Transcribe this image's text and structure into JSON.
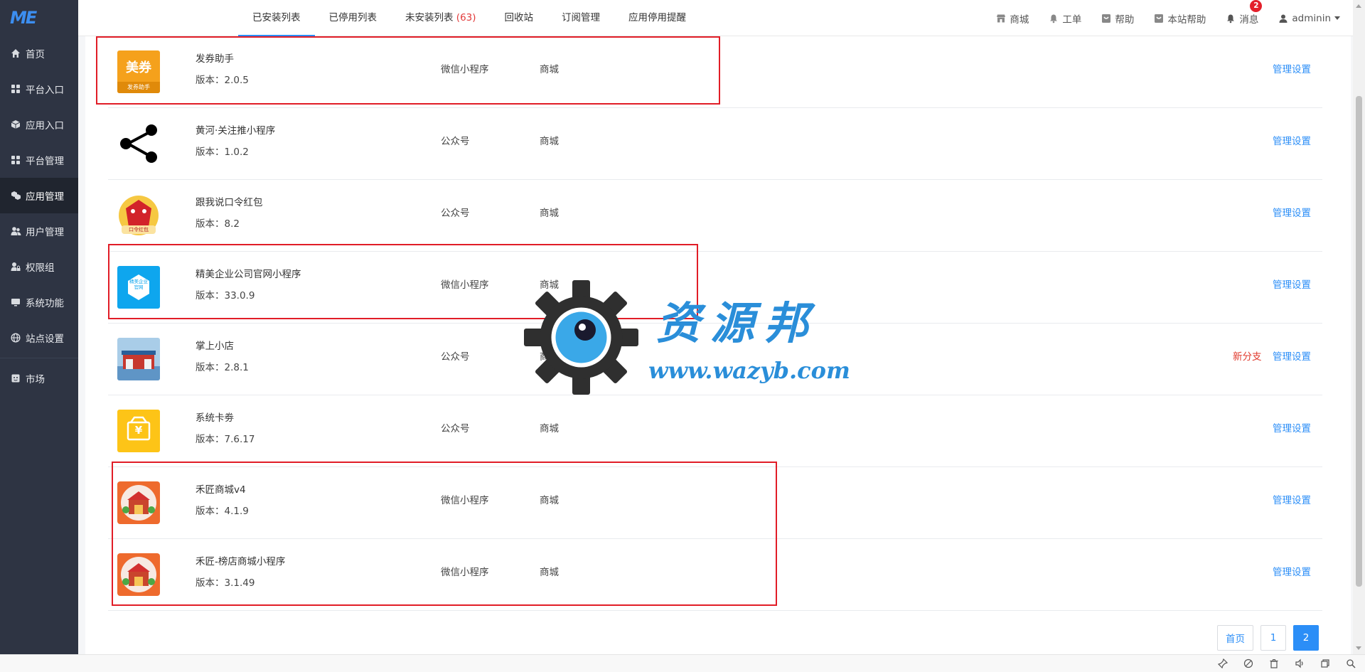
{
  "logo": {
    "text": "ME"
  },
  "sidebar": {
    "items": [
      {
        "label": "首页",
        "icon": "home-icon"
      },
      {
        "label": "平台入口",
        "icon": "grid-icon"
      },
      {
        "label": "应用入口",
        "icon": "cube-icon"
      },
      {
        "label": "平台管理",
        "icon": "grid-icon"
      },
      {
        "label": "应用管理",
        "icon": "cubes-icon",
        "active": true
      },
      {
        "label": "用户管理",
        "icon": "users-icon"
      },
      {
        "label": "权限组",
        "icon": "user-lock-icon"
      },
      {
        "label": "系统功能",
        "icon": "monitor-icon"
      },
      {
        "label": "站点设置",
        "icon": "globe-icon"
      }
    ],
    "market": {
      "label": "市场",
      "icon": "shop-icon"
    }
  },
  "tabs": [
    {
      "label": "已安装列表",
      "active": true
    },
    {
      "label": "已停用列表"
    },
    {
      "label": "未安装列表",
      "count": "(63)"
    },
    {
      "label": "回收站"
    },
    {
      "label": "订阅管理"
    },
    {
      "label": "应用停用提醒"
    }
  ],
  "right_nav": {
    "shop": "商城",
    "ticket": "工单",
    "help": "帮助",
    "site_help": "本站帮助",
    "messages": "消息",
    "message_count": "2",
    "user": "adminin"
  },
  "apps": [
    {
      "name": "发券助手",
      "version": "版本：2.0.5",
      "type": "微信小程序",
      "category": "商城",
      "action": "管理设置",
      "icon_text": "美券",
      "icon_sub": "发券助手"
    },
    {
      "name": "黄河·关注推小程序",
      "version": "版本：1.0.2",
      "type": "公众号",
      "category": "商城",
      "action": "管理设置"
    },
    {
      "name": "跟我说口令红包",
      "version": "版本：8.2",
      "type": "公众号",
      "category": "商城",
      "action": "管理设置",
      "icon_text": "口令红包"
    },
    {
      "name": "精美企业公司官网小程序",
      "version": "版本：33.0.9",
      "type": "微信小程序",
      "category": "商城",
      "action": "管理设置",
      "icon_text": "精美企业官网"
    },
    {
      "name": "掌上小店",
      "version": "版本：2.8.1",
      "type": "公众号",
      "category": "商城",
      "action": "管理设置",
      "branch": "新分支"
    },
    {
      "name": "系统卡劵",
      "version": "版本：7.6.17",
      "type": "公众号",
      "category": "商城",
      "action": "管理设置",
      "icon_text": "¥"
    },
    {
      "name": "禾匠商城v4",
      "version": "版本：4.1.9",
      "type": "微信小程序",
      "category": "商城",
      "action": "管理设置"
    },
    {
      "name": "禾匠-榜店商城小程序",
      "version": "版本：3.1.49",
      "type": "微信小程序",
      "category": "商城",
      "action": "管理设置"
    }
  ],
  "pagination": {
    "first": "首页",
    "pages": [
      "1",
      "2"
    ],
    "current": "2"
  },
  "watermark": {
    "title": "资源邦",
    "url": "www.wazyb.com"
  },
  "colors": {
    "accent": "#2b8ef7",
    "sidebar_bg": "#2e3443",
    "highlight": "#e11d27",
    "danger": "#e03a2d"
  }
}
